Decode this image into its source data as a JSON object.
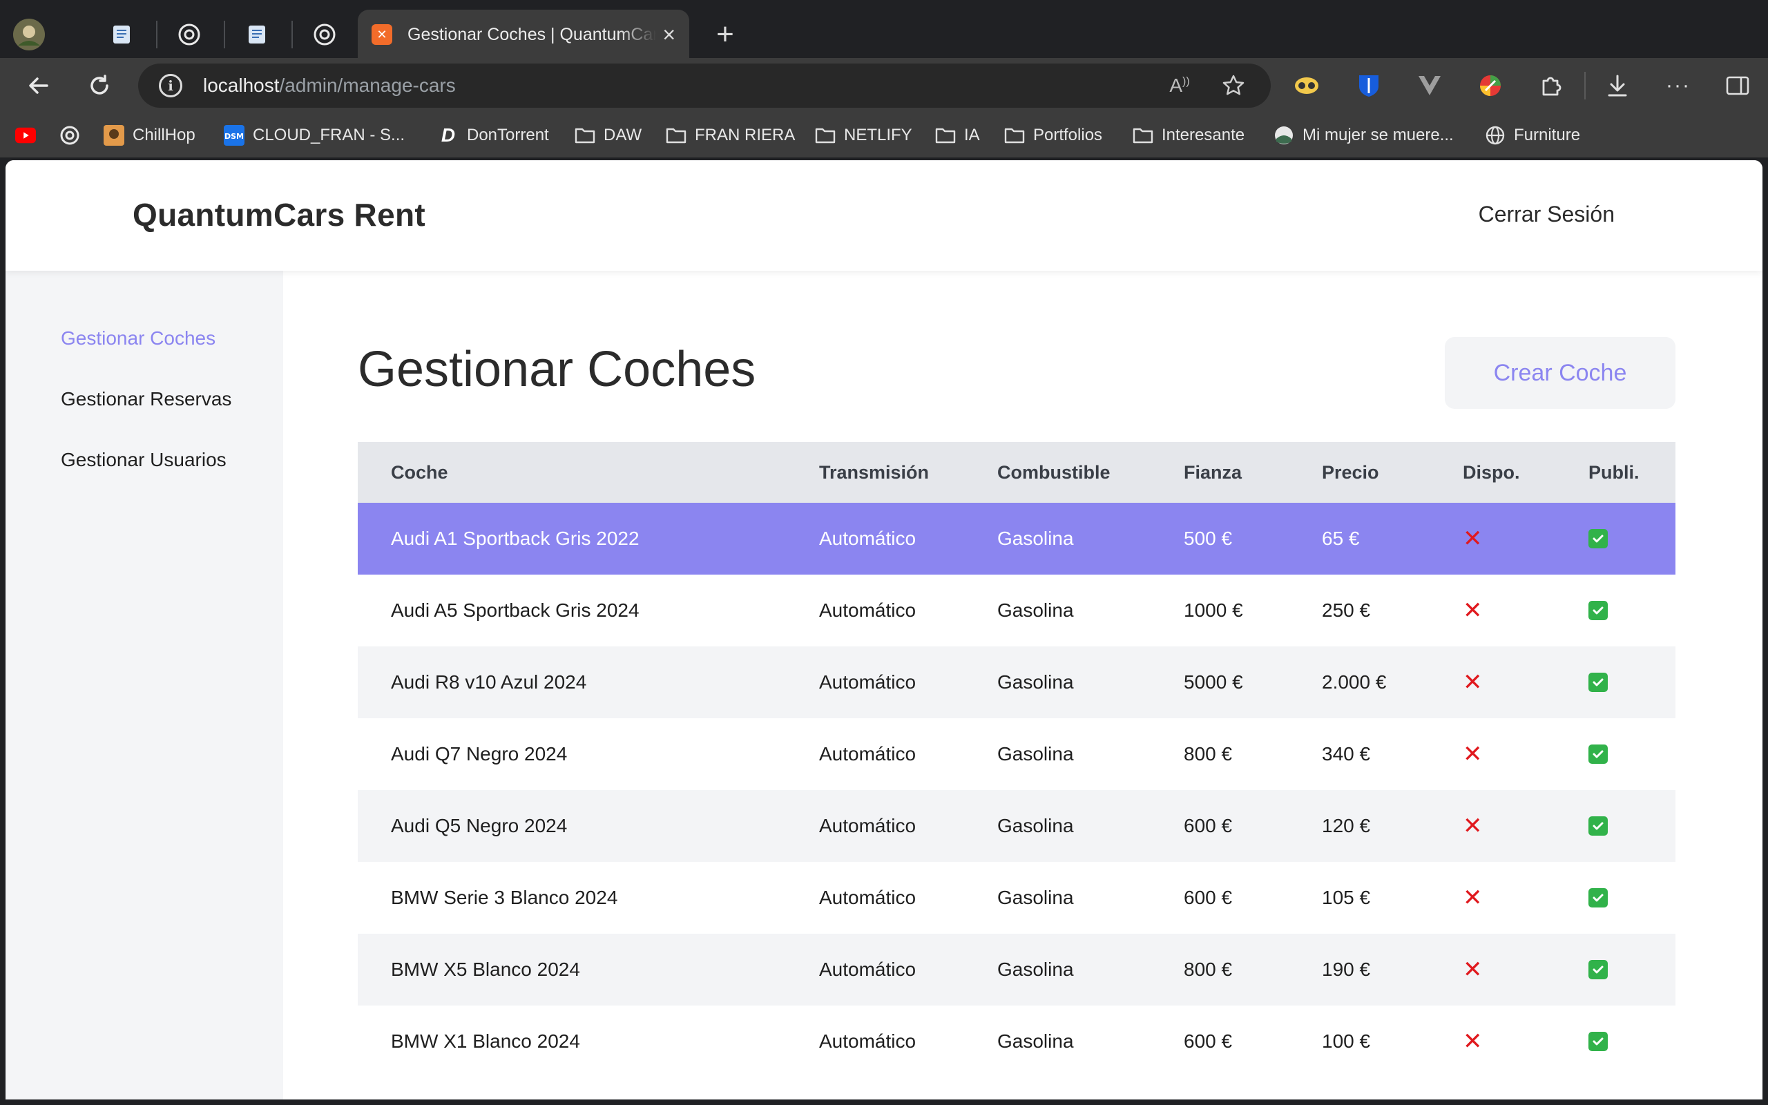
{
  "browser": {
    "active_tab_title": "Gestionar Coches | QuantumCars Rent",
    "url_host": "localhost",
    "url_path": "/admin/manage-cars",
    "bookmarks": [
      {
        "label": "",
        "icon": "youtube-icon"
      },
      {
        "label": "",
        "icon": "openai-icon"
      },
      {
        "label": "ChillHop",
        "icon": "chillhop-icon"
      },
      {
        "label": "CLOUD_FRAN - S...",
        "icon": "dsm-icon"
      },
      {
        "label": "DonTorrent",
        "icon": "dontorrent-icon"
      },
      {
        "label": "DAW",
        "icon": "folder-icon"
      },
      {
        "label": "FRAN RIERA",
        "icon": "folder-icon"
      },
      {
        "label": "NETLIFY",
        "icon": "folder-icon"
      },
      {
        "label": "IA",
        "icon": "folder-icon"
      },
      {
        "label": "Portfolios",
        "icon": "folder-icon"
      },
      {
        "label": "Interesante",
        "icon": "folder-icon"
      },
      {
        "label": "Mi mujer se muere...",
        "icon": "video-icon"
      },
      {
        "label": "Furniture",
        "icon": "globe-icon"
      }
    ]
  },
  "site": {
    "brand": "QuantumCars Rent",
    "logout": "Cerrar Sesión"
  },
  "sidebar": {
    "items": [
      {
        "label": "Gestionar Coches",
        "active": true
      },
      {
        "label": "Gestionar Reservas",
        "active": false
      },
      {
        "label": "Gestionar Usuarios",
        "active": false
      }
    ]
  },
  "main": {
    "title": "Gestionar Coches",
    "create_button": "Crear Coche",
    "table": {
      "columns": [
        "Coche",
        "Transmisión",
        "Combustible",
        "Fianza",
        "Precio",
        "Dispo.",
        "Publi."
      ],
      "rows": [
        {
          "coche": "Audi A1 Sportback Gris 2022",
          "transmision": "Automático",
          "combustible": "Gasolina",
          "fianza": "500 €",
          "precio": "65 €",
          "disponible": false,
          "publicado": true,
          "selected": true
        },
        {
          "coche": "Audi A5 Sportback Gris 2024",
          "transmision": "Automático",
          "combustible": "Gasolina",
          "fianza": "1000 €",
          "precio": "250 €",
          "disponible": false,
          "publicado": true
        },
        {
          "coche": "Audi R8 v10 Azul 2024",
          "transmision": "Automático",
          "combustible": "Gasolina",
          "fianza": "5000 €",
          "precio": "2.000 €",
          "disponible": false,
          "publicado": true
        },
        {
          "coche": "Audi Q7 Negro 2024",
          "transmision": "Automático",
          "combustible": "Gasolina",
          "fianza": "800 €",
          "precio": "340 €",
          "disponible": false,
          "publicado": true
        },
        {
          "coche": "Audi Q5 Negro 2024",
          "transmision": "Automático",
          "combustible": "Gasolina",
          "fianza": "600 €",
          "precio": "120 €",
          "disponible": false,
          "publicado": true
        },
        {
          "coche": "BMW Serie 3 Blanco 2024",
          "transmision": "Automático",
          "combustible": "Gasolina",
          "fianza": "600 €",
          "precio": "105 €",
          "disponible": false,
          "publicado": true
        },
        {
          "coche": "BMW X5 Blanco 2024",
          "transmision": "Automático",
          "combustible": "Gasolina",
          "fianza": "800 €",
          "precio": "190 €",
          "disponible": false,
          "publicado": true
        },
        {
          "coche": "BMW X1 Blanco 2024",
          "transmision": "Automático",
          "combustible": "Gasolina",
          "fianza": "600 €",
          "precio": "100 €",
          "disponible": false,
          "publicado": true
        }
      ]
    }
  },
  "colors": {
    "accent": "#8b85f0",
    "unavailable": "#e0191e",
    "published": "#31b24a"
  }
}
